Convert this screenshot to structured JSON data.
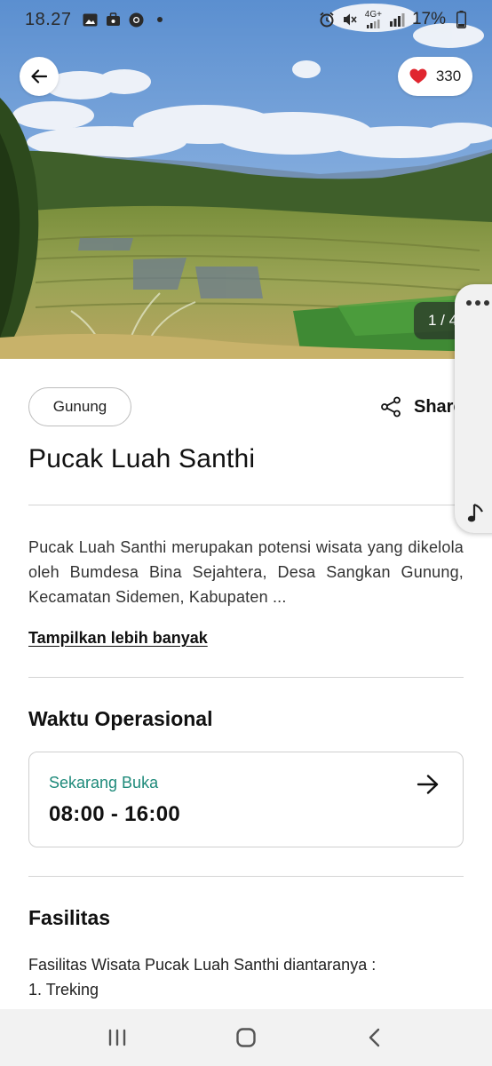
{
  "status_bar": {
    "time": "18.27",
    "network": "4G+",
    "battery_percent": "17%"
  },
  "hero": {
    "like_count": "330",
    "image_counter": "1 / 4",
    "colors": {
      "sky": "#6f9fd8",
      "heart": "#e0262f"
    }
  },
  "place": {
    "category": "Gunung",
    "share_label": "Share",
    "title": "Pucak Luah Santhi",
    "description": "Pucak Luah Santhi merupakan potensi wisata yang dikelola oleh Bumdesa Bina Sejahtera, Desa Sangkan Gunung, Kecamatan Sidemen, Kabupaten ...",
    "show_more": "Tampilkan lebih banyak"
  },
  "operational": {
    "heading": "Waktu Operasional",
    "status": "Sekarang Buka",
    "hours": "08:00 - 16:00",
    "status_color": "#1e8a7a"
  },
  "facilities": {
    "heading": "Fasilitas",
    "intro": "Fasilitas Wisata Pucak Luah Santhi diantaranya :",
    "items": [
      "1. Treking"
    ]
  },
  "icons": {
    "back": "arrow-left-icon",
    "like": "heart-icon",
    "share": "share-icon",
    "hours_arrow": "arrow-right-icon",
    "edge_more": "more-horizontal-icon",
    "edge_music": "music-note-icon",
    "nav_recents": "recents-icon",
    "nav_home": "home-icon",
    "nav_back": "chevron-left-icon"
  }
}
